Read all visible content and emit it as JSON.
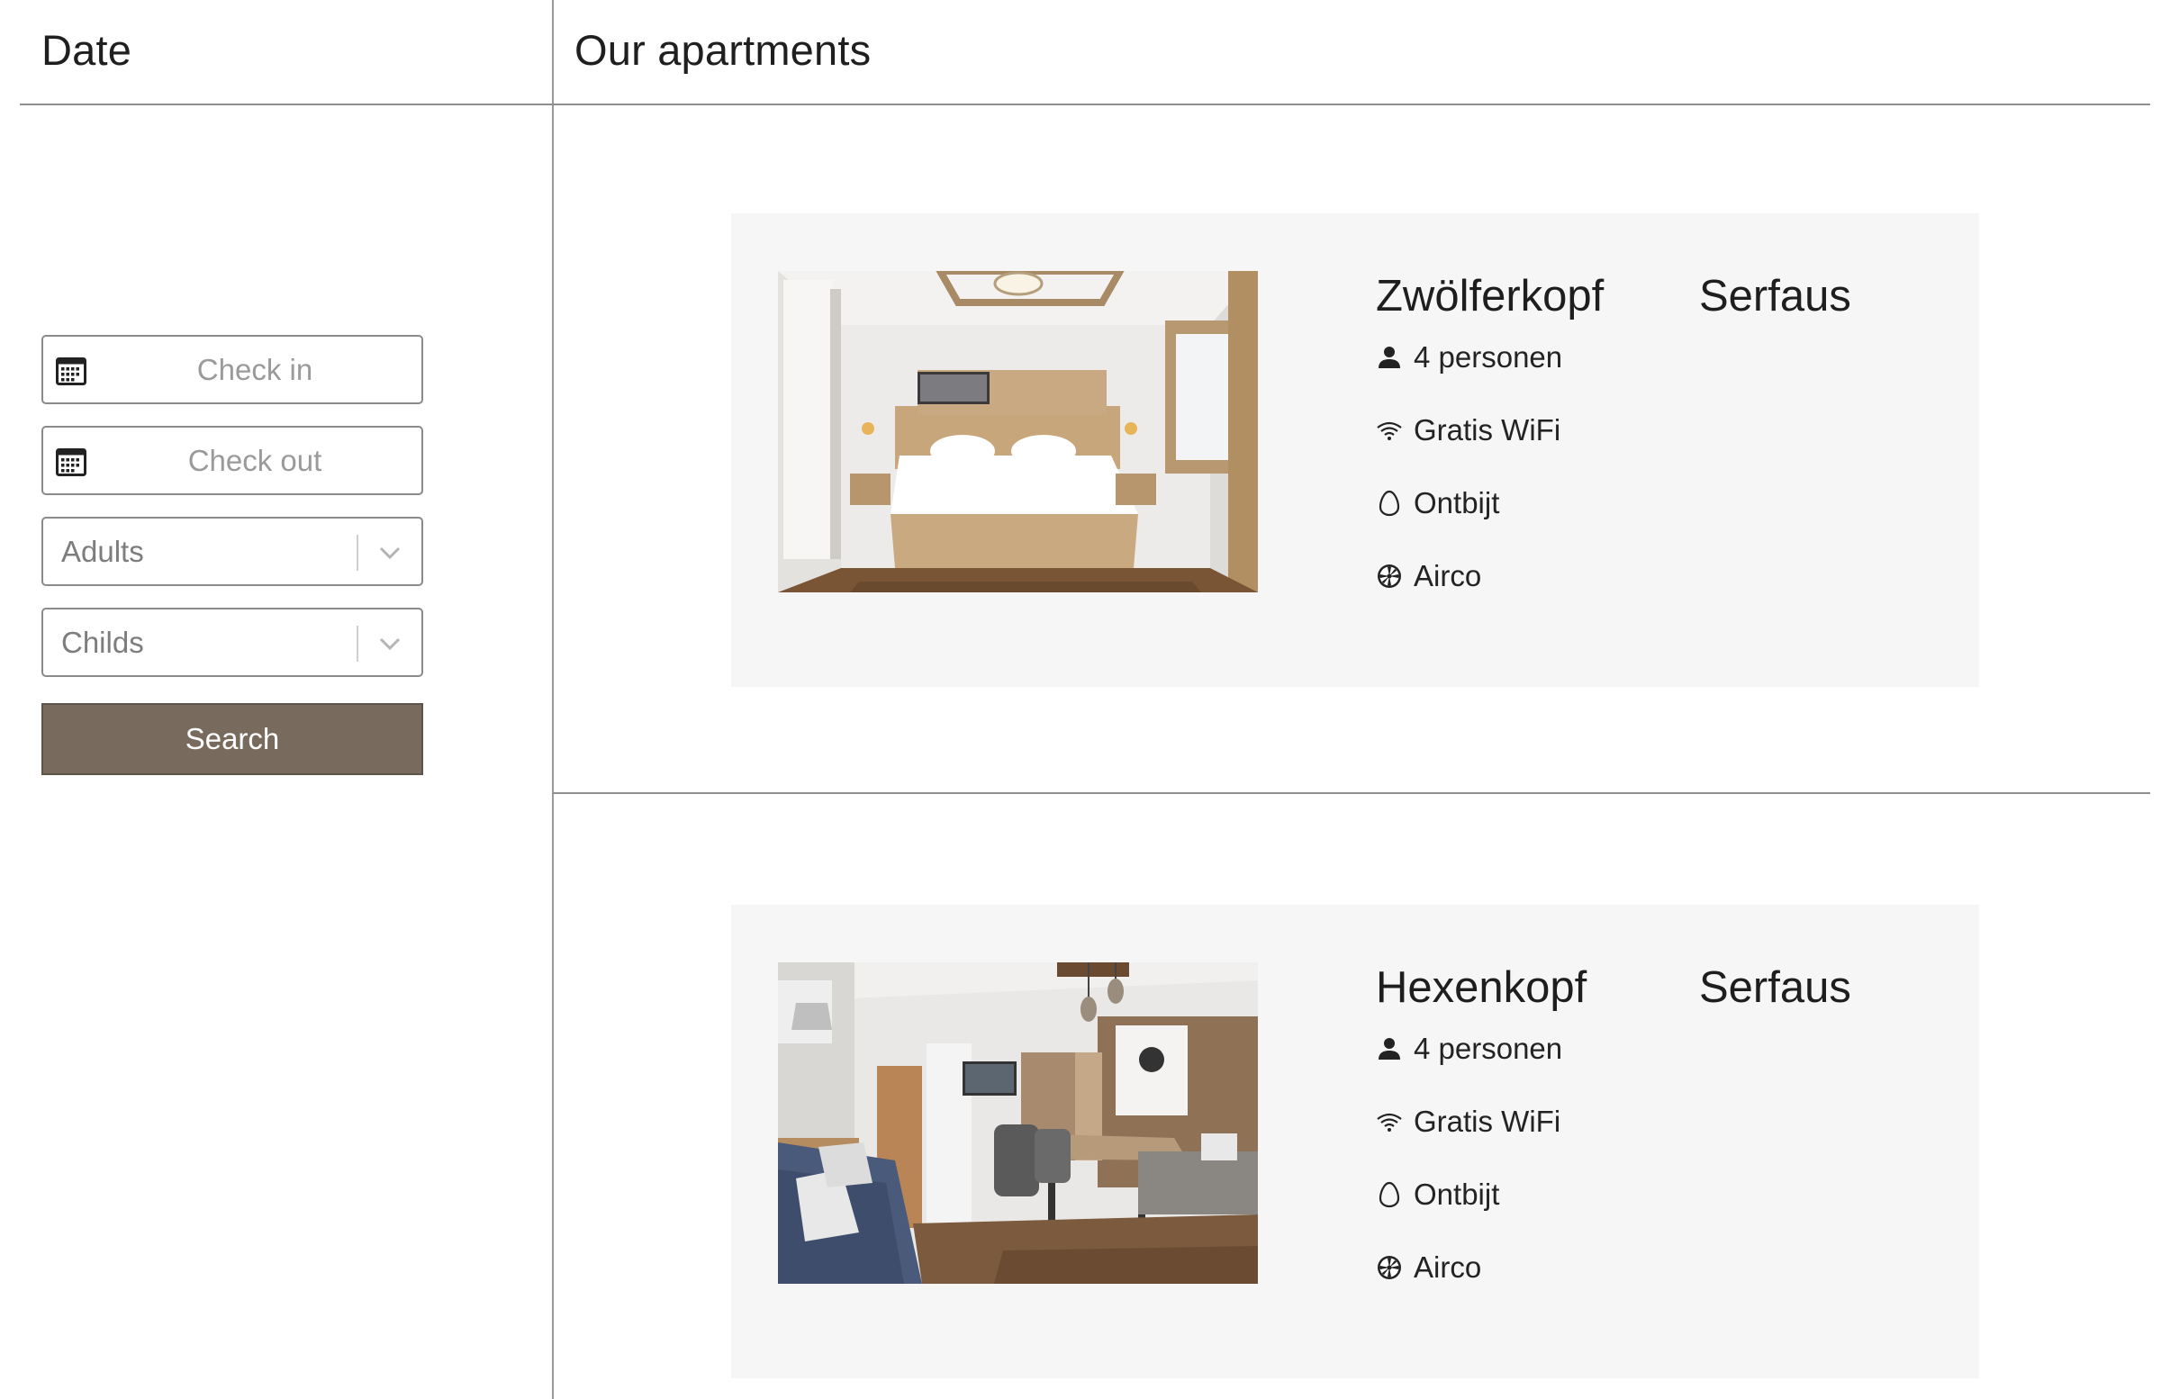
{
  "sidebar": {
    "heading": "Date",
    "checkin_placeholder": "Check in",
    "checkout_placeholder": "Check out",
    "adults_placeholder": "Adults",
    "childs_placeholder": "Childs",
    "search_label": "Search"
  },
  "main": {
    "heading": "Our apartments",
    "apartments": [
      {
        "name": "Zwölferkopf",
        "location": "Serfaus",
        "photo_icon": "bedroom-photo",
        "features": [
          {
            "icon": "person-icon",
            "label": "4 personen"
          },
          {
            "icon": "wifi-icon",
            "label": "Gratis WiFi"
          },
          {
            "icon": "egg-icon",
            "label": "Ontbijt"
          },
          {
            "icon": "fan-icon",
            "label": "Airco"
          }
        ]
      },
      {
        "name": "Hexenkopf",
        "location": "Serfaus",
        "photo_icon": "living-room-photo",
        "features": [
          {
            "icon": "person-icon",
            "label": "4 personen"
          },
          {
            "icon": "wifi-icon",
            "label": "Gratis WiFi"
          },
          {
            "icon": "egg-icon",
            "label": "Ontbijt"
          },
          {
            "icon": "fan-icon",
            "label": "Airco"
          }
        ]
      }
    ]
  },
  "colors": {
    "search_button": "#786b5e",
    "card_background": "#f6f6f6",
    "divider": "#8f8f8f"
  }
}
